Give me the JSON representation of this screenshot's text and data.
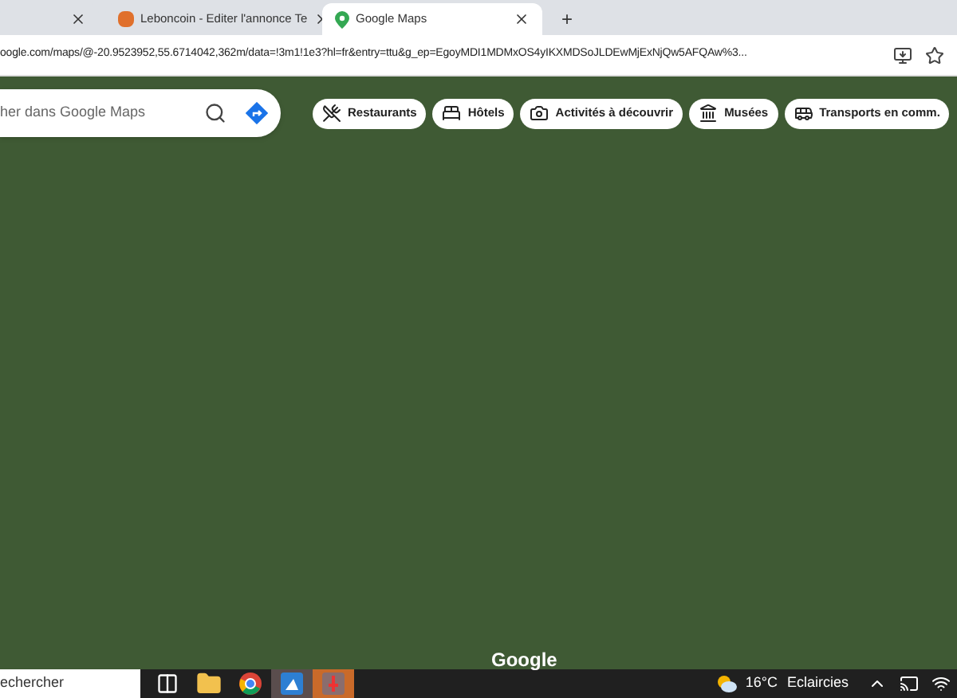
{
  "tabs": [
    {
      "selected": false
    },
    {
      "title": "Leboncoin - Editer l'annonce Te",
      "selected": false
    },
    {
      "title": "Google Maps",
      "selected": true
    }
  ],
  "new_tab": "+",
  "address_bar": {
    "url": "oogle.com/maps/@-20.9523952,55.6714042,362m/data=!3m1!1e3?hl=fr&entry=ttu&g_ep=EgoyMDI1MDMxOS4yIKXMDSoJLDEwMjExNjQw5AFQAw%3..."
  },
  "search": {
    "placeholder": "her dans Google Maps"
  },
  "chips": [
    {
      "label": "Restaurants",
      "kind": "restaurant"
    },
    {
      "label": "Hôtels",
      "kind": "hotel"
    },
    {
      "label": "Activités à découvrir",
      "kind": "camera"
    },
    {
      "label": "Musées",
      "kind": "museum"
    },
    {
      "label": "Transports en comm.",
      "kind": "transit"
    }
  ],
  "map": {
    "logo": "Google"
  },
  "taskbar": {
    "search_placeholder": "echercher",
    "apps": [
      {
        "kind": "taskview",
        "selected": false
      },
      {
        "kind": "folder",
        "selected": false
      },
      {
        "kind": "chrome",
        "selected": false
      },
      {
        "kind": "app",
        "selected": true
      },
      {
        "kind": "app2",
        "selected": true
      }
    ],
    "temperature": "16°C",
    "weather": "Eclaircies"
  }
}
